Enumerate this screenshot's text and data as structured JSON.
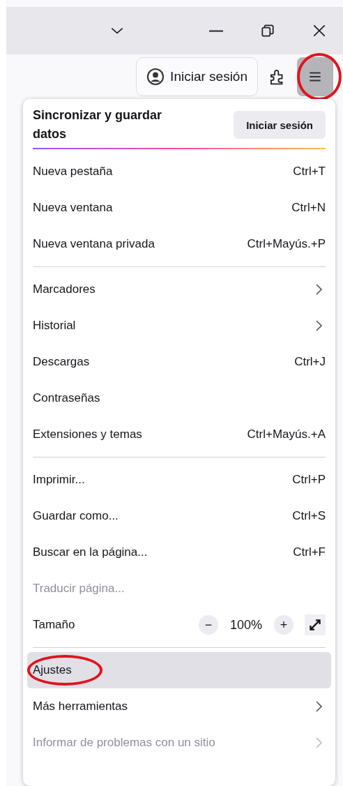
{
  "titlebar": {
    "buttons": [
      {
        "kind": "dropdown"
      },
      {
        "kind": "minimize"
      },
      {
        "kind": "restore"
      },
      {
        "kind": "close"
      }
    ]
  },
  "toolbar": {
    "sign_in": "Iniciar sesión",
    "menu_highlighted": true
  },
  "menu": {
    "sync": {
      "title": "Sincronizar y guardar datos",
      "button": "Iniciar sesión"
    },
    "items": [
      {
        "kind": "item",
        "label": "Nueva pestaña",
        "shortcut": "Ctrl+T",
        "submenu": false,
        "disabled": false,
        "selected": false
      },
      {
        "kind": "item",
        "label": "Nueva ventana",
        "shortcut": "Ctrl+N",
        "submenu": false,
        "disabled": false,
        "selected": false
      },
      {
        "kind": "item",
        "label": "Nueva ventana privada",
        "shortcut": "Ctrl+Mayús.+P",
        "submenu": false,
        "disabled": false,
        "selected": false
      },
      {
        "kind": "divider"
      },
      {
        "kind": "item",
        "label": "Marcadores",
        "submenu": true,
        "disabled": false,
        "selected": false
      },
      {
        "kind": "item",
        "label": "Historial",
        "submenu": true,
        "disabled": false,
        "selected": false
      },
      {
        "kind": "item",
        "label": "Descargas",
        "shortcut": "Ctrl+J",
        "submenu": false,
        "disabled": false,
        "selected": false
      },
      {
        "kind": "item",
        "label": "Contraseñas",
        "submenu": false,
        "disabled": false,
        "selected": false
      },
      {
        "kind": "item",
        "label": "Extensiones y temas",
        "shortcut": "Ctrl+Mayús.+A",
        "submenu": false,
        "disabled": false,
        "selected": false
      },
      {
        "kind": "divider"
      },
      {
        "kind": "item",
        "label": "Imprimir...",
        "shortcut": "Ctrl+P",
        "submenu": false,
        "disabled": false,
        "selected": false
      },
      {
        "kind": "item",
        "label": "Guardar como...",
        "shortcut": "Ctrl+S",
        "submenu": false,
        "disabled": false,
        "selected": false
      },
      {
        "kind": "item",
        "label": "Buscar en la página...",
        "shortcut": "Ctrl+F",
        "submenu": false,
        "disabled": false,
        "selected": false
      },
      {
        "kind": "item",
        "label": "Traducir página...",
        "submenu": false,
        "disabled": true,
        "selected": false
      },
      {
        "kind": "zoom",
        "label": "Tamaño",
        "minus": "−",
        "value": "100%",
        "plus": "+"
      },
      {
        "kind": "divider"
      },
      {
        "kind": "item",
        "label": "Ajustes",
        "submenu": false,
        "disabled": false,
        "selected": true,
        "circled": true
      },
      {
        "kind": "item",
        "label": "Más herramientas",
        "submenu": true,
        "disabled": false,
        "selected": false
      },
      {
        "kind": "item",
        "label": "Informar de problemas con un sitio",
        "submenu": true,
        "disabled": true,
        "selected": false
      }
    ]
  }
}
